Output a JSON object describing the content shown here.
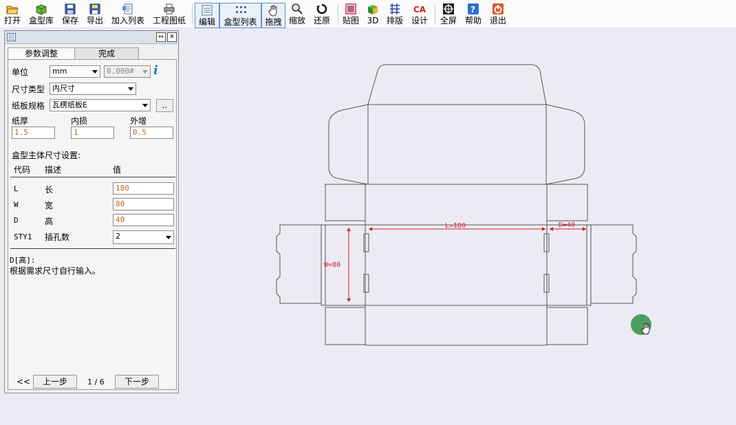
{
  "toolbar": {
    "items": [
      {
        "label": "打开",
        "icon": "folder-open-icon"
      },
      {
        "label": "盒型库",
        "icon": "box-library-icon"
      },
      {
        "label": "保存",
        "icon": "floppy-icon"
      },
      {
        "label": "导出",
        "icon": "export-icon"
      },
      {
        "label": "加入列表",
        "icon": "add-to-list-icon"
      },
      {
        "label": "工程图纸",
        "icon": "printer-icon"
      },
      {
        "label": "编辑",
        "icon": "edit-icon"
      },
      {
        "label": "盒型列表",
        "icon": "grid-list-icon"
      },
      {
        "label": "拖拽",
        "icon": "hand-icon"
      },
      {
        "label": "缩放",
        "icon": "zoom-icon"
      },
      {
        "label": "还原",
        "icon": "restore-icon"
      },
      {
        "label": "贴图",
        "icon": "texture-icon"
      },
      {
        "label": "3D",
        "icon": "cube-3d-icon"
      },
      {
        "label": "排版",
        "icon": "layout-icon"
      },
      {
        "label": "设计",
        "icon": "cad-design-icon"
      },
      {
        "label": "全屏",
        "icon": "fullscreen-icon"
      },
      {
        "label": "帮助",
        "icon": "help-icon"
      },
      {
        "label": "退出",
        "icon": "exit-icon"
      }
    ]
  },
  "panel": {
    "tabs": [
      "参数调整",
      "完成"
    ],
    "unit_label": "单位",
    "unit_value": "mm",
    "precision_value": "0.000#",
    "size_type_label": "尺寸类型",
    "size_type_value": "内尺寸",
    "board_label": "纸板规格",
    "board_value": "瓦楞纸板E",
    "board_more": "..",
    "thickness_label": "纸厚",
    "thickness_value": "1.5",
    "inner_loss_label": "内损",
    "inner_loss_value": "1",
    "outer_add_label": "外增",
    "outer_add_value": "0.5",
    "section_title": "盒型主体尺寸设置:",
    "columns": [
      "代码",
      "描述",
      "值"
    ],
    "rows": [
      {
        "code": "L",
        "desc": "长",
        "value": "180"
      },
      {
        "code": "W",
        "desc": "宽",
        "value": "80"
      },
      {
        "code": "D",
        "desc": "高",
        "value": "40"
      },
      {
        "code": "STY1",
        "desc": "插孔数",
        "value": "2"
      }
    ],
    "hint_title": "D[高]:",
    "hint_text": "根据需求尺寸自行输入。",
    "first": "<<",
    "prev": "上一步",
    "page": "1 / 6",
    "next": "下一步"
  },
  "drawing": {
    "dim_L": "L=180",
    "dim_W": "W=80",
    "dim_D": "D=40",
    "line_color": "#555555",
    "dim_color": "#d42020"
  },
  "colors": {
    "accent": "#5d8fcf",
    "background": "#ecebf4"
  }
}
